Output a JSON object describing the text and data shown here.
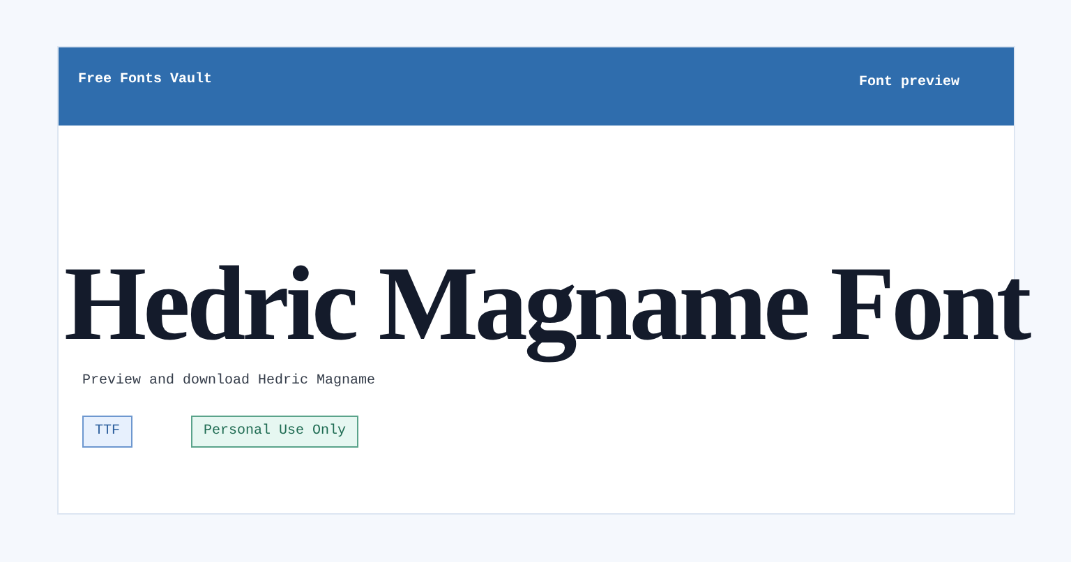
{
  "header": {
    "site_name": "Free Fonts Vault",
    "page_label": "Font preview"
  },
  "preview": {
    "title": "Hedric Magname Font",
    "subtitle": "Preview and download Hedric Magname"
  },
  "tags": [
    {
      "kind": "format",
      "label": "TTF"
    },
    {
      "kind": "license",
      "label": "Personal Use Only"
    }
  ]
}
